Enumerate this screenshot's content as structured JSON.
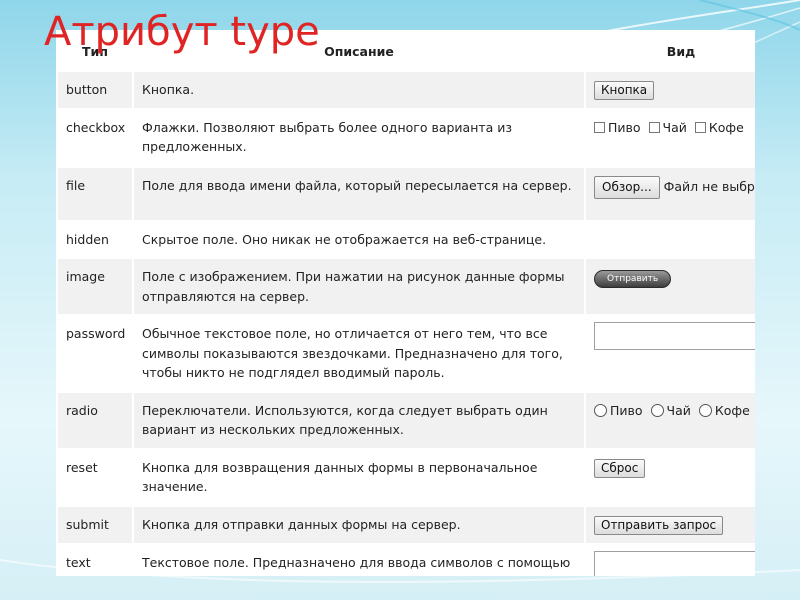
{
  "title": "Атрибут type",
  "table": {
    "headers": {
      "type": "Тип",
      "description": "Описание",
      "view": "Вид"
    },
    "rows": [
      {
        "type": "button",
        "description": "Кнопка.",
        "button_label": "Кнопка"
      },
      {
        "type": "checkbox",
        "description": "Флажки. Позволяют выбрать более одного варианта из предложенных.",
        "options": [
          "Пиво",
          "Чай",
          "Кофе"
        ]
      },
      {
        "type": "file",
        "description": "Поле для ввода имени файла, который пересылается на сервер.",
        "button_label": "Обзор...",
        "status": "Файл не выбр"
      },
      {
        "type": "hidden",
        "description": "Скрытое поле. Оно никак не отображается на веб-странице."
      },
      {
        "type": "image",
        "description": "Поле с изображением. При нажатии на рисунок данные формы отправляются на сервер.",
        "image_label": "Отправить"
      },
      {
        "type": "password",
        "description": "Обычное текстовое поле, но отличается от него тем, что все символы показываются звездочками. Предназначено для того, чтобы никто не подглядел вводимый пароль."
      },
      {
        "type": "radio",
        "description": "Переключатели. Используются, когда следует выбрать один вариант из нескольких предложенных.",
        "options": [
          "Пиво",
          "Чай",
          "Кофе"
        ]
      },
      {
        "type": "reset",
        "description": "Кнопка для возвращения данных формы в первоначальное значение.",
        "button_label": "Сброс"
      },
      {
        "type": "submit",
        "description": "Кнопка для отправки данных формы на сервер.",
        "button_label": "Отправить запрос"
      },
      {
        "type": "text",
        "description": "Текстовое поле. Предназначено для ввода символов с помощью клавиатуры."
      }
    ]
  },
  "colors": {
    "title": "#e02424",
    "row_alt": "#f1f1f1",
    "background": "#c7ecf5"
  }
}
